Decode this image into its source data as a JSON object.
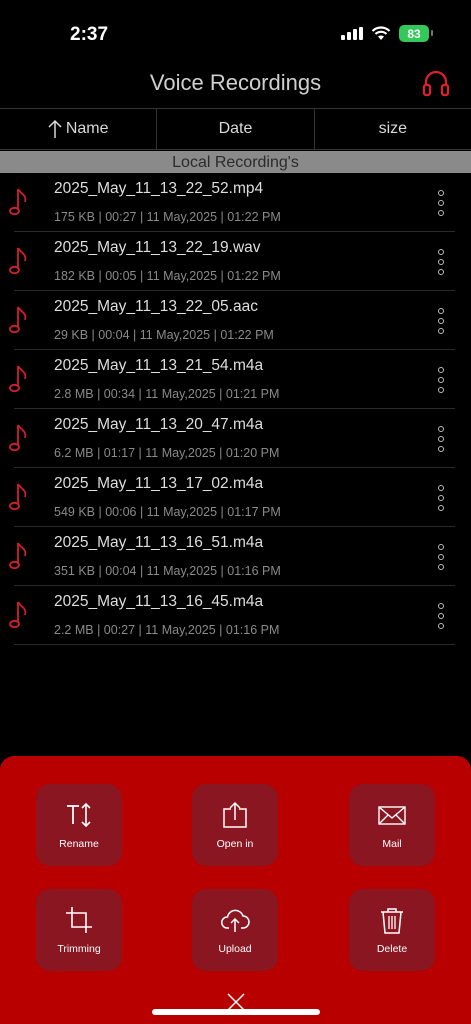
{
  "status": {
    "time": "2:37",
    "battery": "83"
  },
  "nav": {
    "title": "Voice Recordings"
  },
  "sort": {
    "name": "Name",
    "date": "Date",
    "size": "size"
  },
  "section": {
    "title": "Local Recording's"
  },
  "recordings": [
    {
      "name": "2025_May_11_13_22_52.mp4",
      "meta": "175 KB | 00:27 | 11 May,2025 | 01:22 PM"
    },
    {
      "name": "2025_May_11_13_22_19.wav",
      "meta": "182 KB | 00:05 | 11 May,2025 | 01:22 PM"
    },
    {
      "name": "2025_May_11_13_22_05.aac",
      "meta": "29 KB | 00:04 | 11 May,2025 | 01:22 PM"
    },
    {
      "name": "2025_May_11_13_21_54.m4a",
      "meta": "2.8 MB | 00:34 | 11 May,2025 | 01:21 PM"
    },
    {
      "name": "2025_May_11_13_20_47.m4a",
      "meta": "6.2 MB | 01:17 | 11 May,2025 | 01:20 PM"
    },
    {
      "name": "2025_May_11_13_17_02.m4a",
      "meta": "549 KB | 00:06 | 11 May,2025 | 01:17 PM"
    },
    {
      "name": "2025_May_11_13_16_51.m4a",
      "meta": "351 KB | 00:04 | 11 May,2025 | 01:16 PM"
    },
    {
      "name": "2025_May_11_13_16_45.m4a",
      "meta": "2.2 MB | 00:27 | 11 May,2025 | 01:16 PM"
    }
  ],
  "actions": {
    "rename": "Rename",
    "open_in": "Open in",
    "mail": "Mail",
    "trimming": "Trimming",
    "upload": "Upload",
    "delete": "Delete"
  },
  "colors": {
    "accent": "#b80000",
    "action_bg": "#8a1622",
    "note": "#d0202a",
    "battery": "#34c759"
  }
}
